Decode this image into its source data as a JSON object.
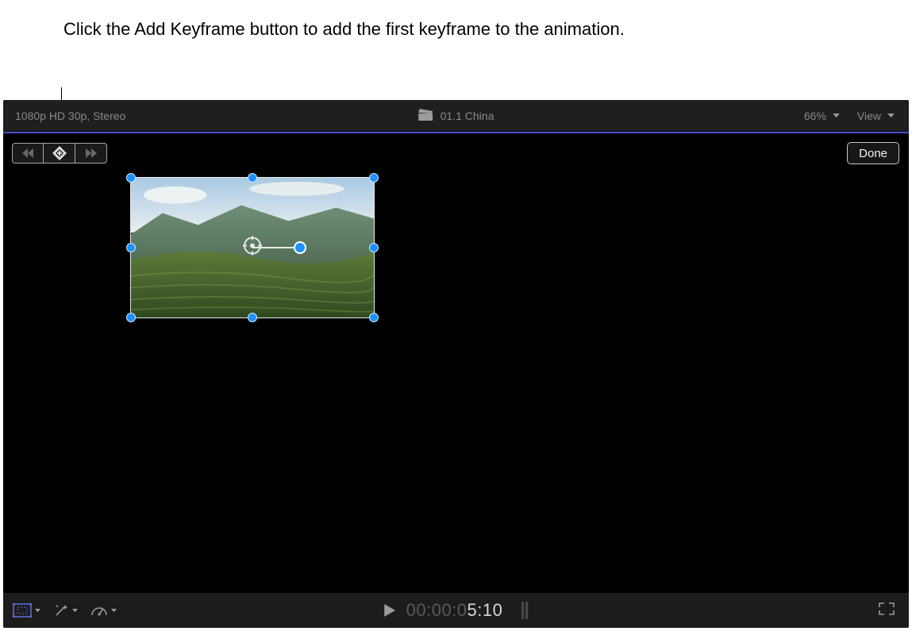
{
  "callout": {
    "text": "Click the Add Keyframe button to add the first keyframe to the animation."
  },
  "topbar": {
    "format": "1080p HD 30p, Stereo",
    "clip_name": "01.1 China",
    "zoom_label": "66%",
    "view_label": "View"
  },
  "overlay": {
    "prev_keyframe_name": "previous-keyframe",
    "add_keyframe_name": "add-keyframe",
    "next_keyframe_name": "next-keyframe",
    "done_label": "Done"
  },
  "bottombar": {
    "tools": {
      "transform": "transform-tool",
      "enhance": "enhance-tool",
      "retime": "retime-tool"
    },
    "play_name": "play",
    "timecode_dim": "00:00:0",
    "timecode_bright": "5:10",
    "fullscreen_name": "fullscreen"
  }
}
